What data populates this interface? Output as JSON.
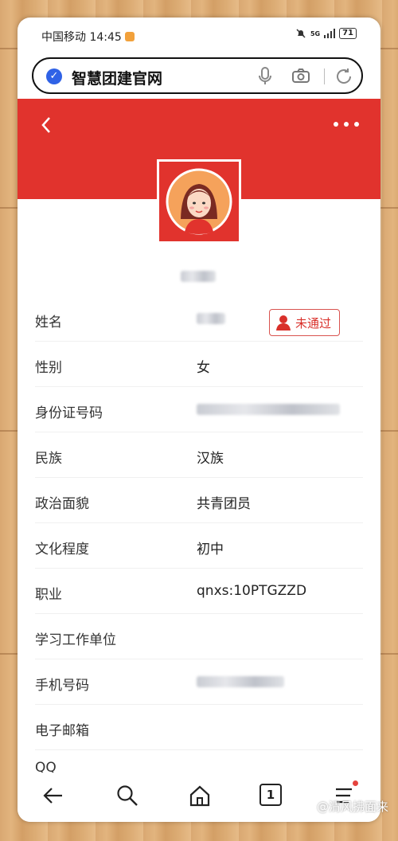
{
  "status_bar": {
    "carrier_time": "中国移动 14:45",
    "network": "5G",
    "battery": "71"
  },
  "browser": {
    "url_text": "智慧团建官网"
  },
  "header": {
    "back_icon": "chevron-left-icon",
    "menu_icon": "more-dots-icon",
    "bg_color": "#e1332d"
  },
  "status_badge": {
    "label": "未通过",
    "color": "#d9302a"
  },
  "profile_fields": [
    {
      "label": "姓名",
      "value": ""
    },
    {
      "label": "性别",
      "value": "女"
    },
    {
      "label": "身份证号码",
      "value": ""
    },
    {
      "label": "民族",
      "value": "汉族"
    },
    {
      "label": "政治面貌",
      "value": "共青团员"
    },
    {
      "label": "文化程度",
      "value": "初中"
    },
    {
      "label": "职业",
      "value": "qnxs:10PTGZZD"
    },
    {
      "label": "学习工作单位",
      "value": ""
    },
    {
      "label": "手机号码",
      "value": ""
    },
    {
      "label": "电子邮箱",
      "value": ""
    }
  ],
  "partial_row_label": "QQ",
  "bottom_nav": {
    "tab_count": "1"
  },
  "watermark": "@清风拂面来"
}
